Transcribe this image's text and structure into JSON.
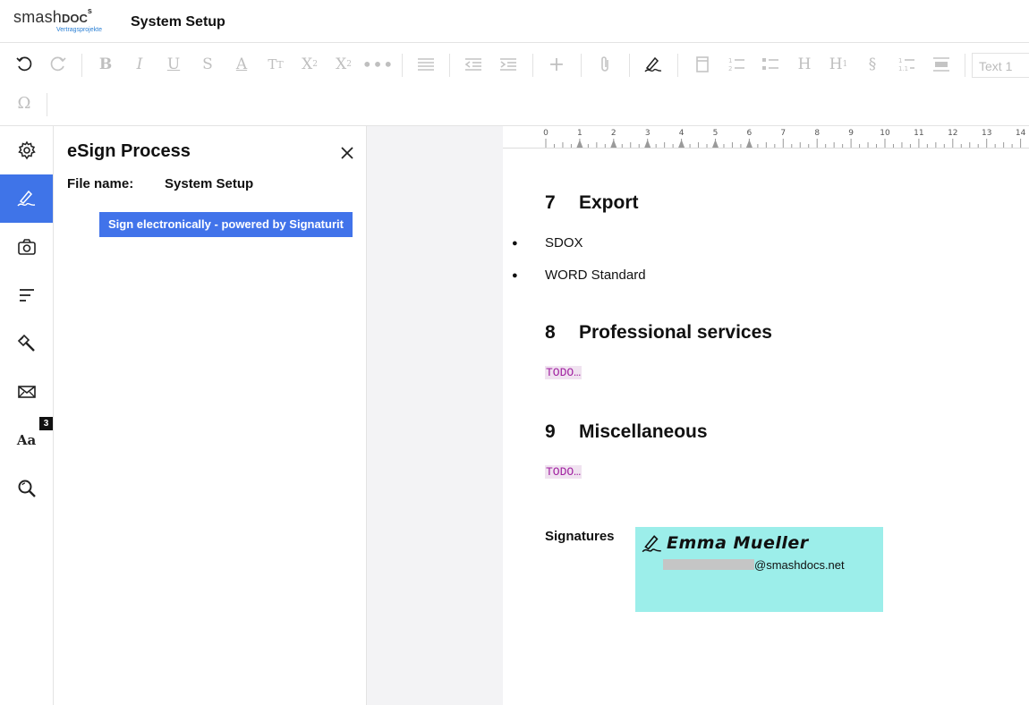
{
  "app": {
    "logo_word": "smash",
    "logo_bold": "DOC",
    "logo_sup": "s",
    "logo_tagline": "Vertragsprojekte",
    "document_title": "System Setup"
  },
  "toolbar": {
    "style_select_value": "Text 1",
    "icons": [
      "undo-icon",
      "redo-icon",
      "bold-icon",
      "italic-icon",
      "underline-icon",
      "strikethrough-icon",
      "text-color-icon",
      "font-size-icon",
      "superscript-icon",
      "subscript-icon",
      "more-icon",
      "align-icon",
      "outdent-icon",
      "indent-icon",
      "add-icon",
      "attachment-icon",
      "signature-icon",
      "page-icon",
      "ordered-list-icon",
      "bullet-list-icon",
      "heading-icon",
      "heading-level-icon",
      "paragraph-icon",
      "numbering-icon",
      "block-icon",
      "omega-icon"
    ]
  },
  "rail": {
    "items": [
      "settings-icon",
      "esign-icon",
      "camera-icon",
      "outline-icon",
      "design-icon",
      "mail-icon",
      "typography-icon",
      "search-icon"
    ],
    "badge": "3"
  },
  "panel": {
    "title": "eSign Process",
    "file_name_label": "File name:",
    "file_name_value": "System Setup",
    "sign_button": "Sign electronically - powered by Signaturit"
  },
  "ruler": {
    "ticks": [
      "0",
      "1",
      "2",
      "3",
      "4",
      "5",
      "6",
      "7",
      "8",
      "9",
      "10",
      "11",
      "12",
      "13",
      "14"
    ]
  },
  "document": {
    "sections": [
      {
        "number": "7",
        "title": "Export",
        "bullets": [
          "SDOX",
          "WORD Standard"
        ]
      },
      {
        "number": "8",
        "title": "Professional services",
        "todo": "TODO…"
      },
      {
        "number": "9",
        "title": "Miscellaneous",
        "todo": "TODO…"
      }
    ],
    "signatures_label": "Signatures",
    "signature": {
      "name": "Emma Mueller",
      "email_domain": "@smashdocs.net"
    }
  },
  "colors": {
    "accent": "#3f74e8",
    "button": "#4173ea",
    "signature_box": "#9ceeea",
    "todo": "#a020a0"
  }
}
